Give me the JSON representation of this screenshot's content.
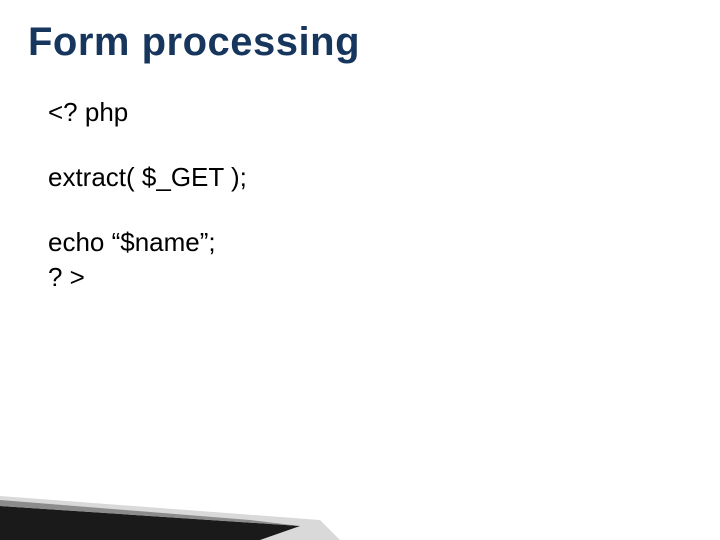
{
  "title": "Form processing",
  "code": {
    "line1": "<? php",
    "line2": "extract( $_GET );",
    "line3": "echo “$name”;",
    "line4": "? >"
  }
}
